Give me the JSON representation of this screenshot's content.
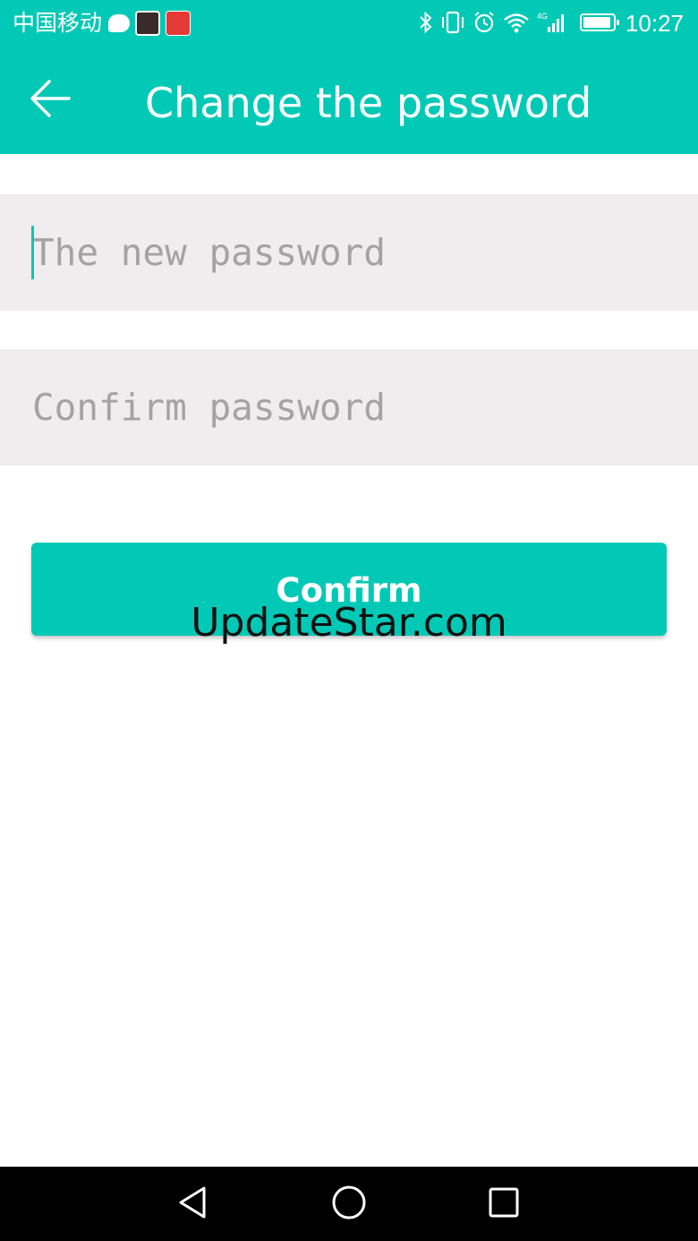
{
  "status_bar": {
    "carrier": "中国移动",
    "time": "10:27",
    "network": "4G",
    "icons": [
      "chat-bubble-icon",
      "app-icon",
      "jd-app-icon",
      "bluetooth-icon",
      "vibrate-icon",
      "alarm-icon",
      "wifi-icon",
      "signal-icon",
      "battery-icon"
    ]
  },
  "app_bar": {
    "back_icon": "arrow-left-icon",
    "title": "Change the password"
  },
  "form": {
    "new_password_placeholder": "The new password",
    "new_password_value": "",
    "confirm_password_placeholder": "Confirm password",
    "confirm_password_value": "",
    "confirm_label": "Confirm"
  },
  "watermark": "UpdateStar.com",
  "nav_bar": {
    "icons": [
      "back-triangle-icon",
      "home-circle-icon",
      "recents-square-icon"
    ]
  },
  "colors": {
    "accent": "#02c9b6",
    "field_background": "#efedee",
    "placeholder": "#a4a2a3"
  }
}
